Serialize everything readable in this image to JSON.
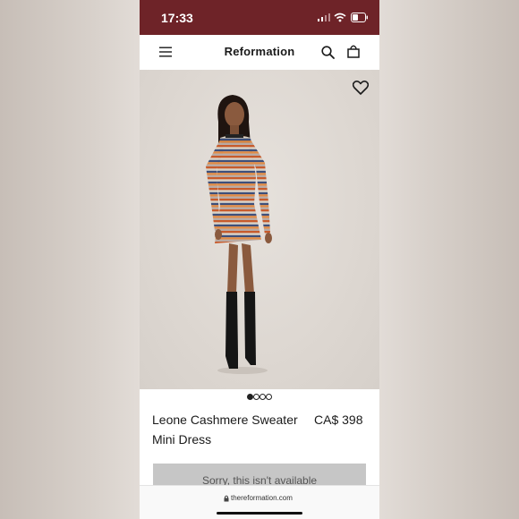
{
  "status_bar": {
    "time": "17:33"
  },
  "header": {
    "brand": "Reformation"
  },
  "product": {
    "name": "Leone Cashmere Sweater Mini Dress",
    "price": "CA$ 398",
    "availability_button": "Sorry, this isn't available",
    "image_count": 4,
    "active_image": 1
  },
  "browser": {
    "url": "thereformation.com"
  },
  "colors": {
    "status_bar": "#6e2328",
    "background": "#ffffff",
    "button_disabled": "#c6c6c6",
    "text": "#1a1a1a"
  },
  "icons": [
    "menu-icon",
    "search-icon",
    "bag-icon",
    "heart-icon",
    "lock-icon",
    "wifi-icon",
    "battery-icon",
    "signal-icon"
  ]
}
